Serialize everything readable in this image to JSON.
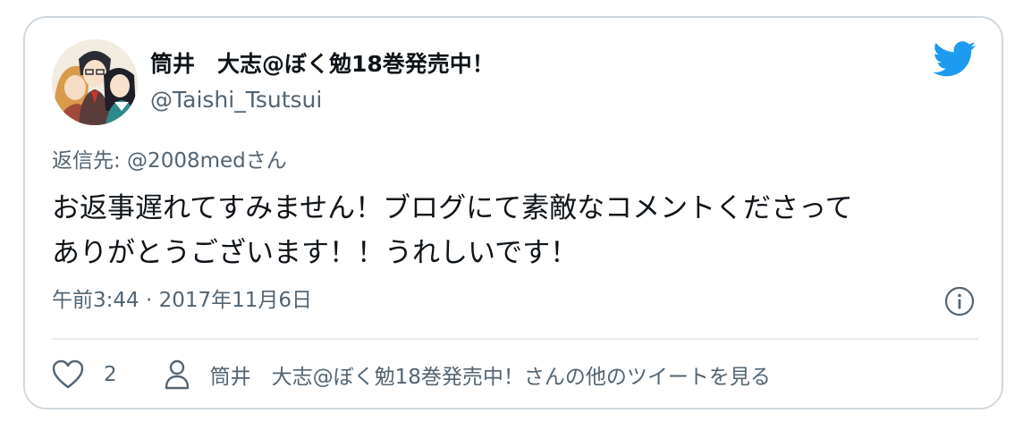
{
  "tweet": {
    "author_name": "筒井　大志@ぼく勉18巻発売中！",
    "author_handle": "@Taishi_Tsutsui",
    "reply_to": "返信先: @2008medさん",
    "text_line1": "お返事遅れてすみません！ブログにて素敵なコメントくださって",
    "text_line2": "ありがとうございます！！うれしいです！",
    "timestamp": "午前3:44 · 2017年11月6日",
    "like_count": "2",
    "more_link": "筒井　大志@ぼく勉18巻発売中！さんの他のツイートを見る"
  },
  "icons": {
    "logo": "twitter-bird-icon",
    "info": "info-icon",
    "like": "heart-icon",
    "profile": "person-icon"
  },
  "colors": {
    "twitter_blue": "#1d9bf0",
    "secondary_text": "#536471",
    "border": "#cfd9de"
  }
}
